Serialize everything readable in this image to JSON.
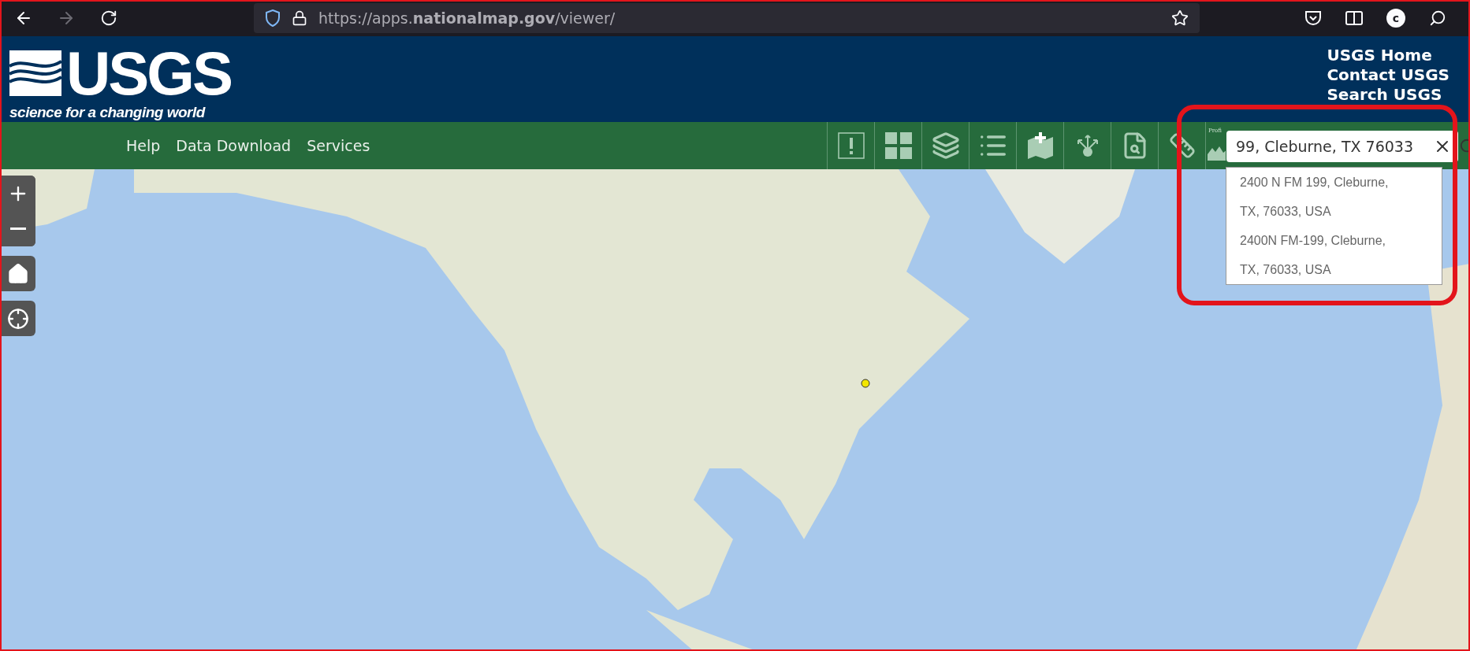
{
  "browser": {
    "url": "https://apps.**nationalmap.gov**/viewer/",
    "forward_disabled": true,
    "profile_initial": "c"
  },
  "header": {
    "logo_text": "USGS",
    "tagline": "science for a changing world",
    "links": [
      "USGS Home",
      "Contact USGS",
      "Search USGS"
    ]
  },
  "nav": {
    "items": [
      "Help",
      "Data Download",
      "Services"
    ]
  },
  "toolbar": {
    "tools": [
      {
        "kind": "alert"
      },
      {
        "kind": "basemap"
      },
      {
        "kind": "layers"
      },
      {
        "kind": "legend"
      },
      {
        "kind": "add-data"
      },
      {
        "kind": "share"
      },
      {
        "kind": "identify"
      },
      {
        "kind": "measure"
      },
      {
        "kind": "profile",
        "label": "Profi"
      }
    ]
  },
  "search": {
    "value": "99, Cleburne, TX 76033",
    "suggestions": [
      "2400 N FM 199, Cleburne, TX, 76033, USA",
      "2400N FM-199, Cleburne, TX, 76033, USA"
    ]
  }
}
